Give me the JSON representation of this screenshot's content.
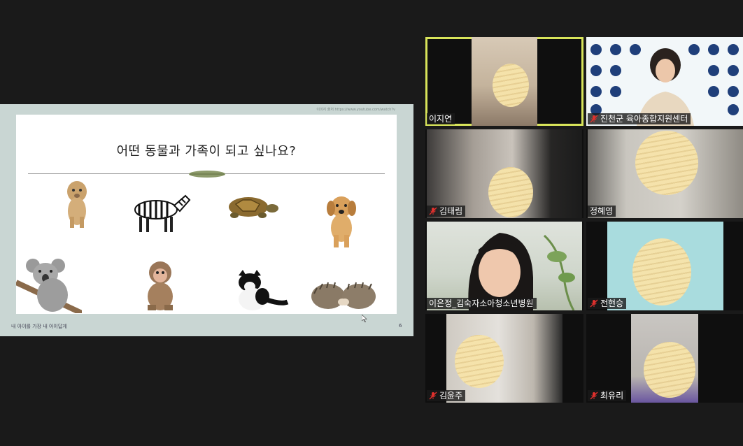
{
  "share": {
    "credit": "이미지 출처 https://www.youtube.com/watch?v",
    "slide_title": "어떤 동물과 가족이 되고 싶나요?",
    "footer": "내 아이를 가장 내 아이답게",
    "page_number": "6",
    "animals": [
      "lion-cub",
      "zebra",
      "turtle",
      "puppy",
      "koala",
      "monkey",
      "cat",
      "hedgehogs"
    ]
  },
  "participants": [
    {
      "name": "이지연",
      "muted": false,
      "active_speaker": true
    },
    {
      "name": "진천군 육아종합지원센터",
      "muted": true,
      "active_speaker": false
    },
    {
      "name": "김태림",
      "muted": true,
      "active_speaker": false
    },
    {
      "name": "정혜영",
      "muted": false,
      "active_speaker": false
    },
    {
      "name": "이은정_김숙자소아청소년병원",
      "muted": false,
      "active_speaker": false
    },
    {
      "name": "전현승",
      "muted": true,
      "active_speaker": false
    },
    {
      "name": "김윤주",
      "muted": true,
      "active_speaker": false
    },
    {
      "name": "최유리",
      "muted": true,
      "active_speaker": false
    }
  ],
  "colors": {
    "active_speaker_border": "#d8e45a",
    "muted_icon": "#e0302d",
    "background": "#1a1a1a"
  }
}
